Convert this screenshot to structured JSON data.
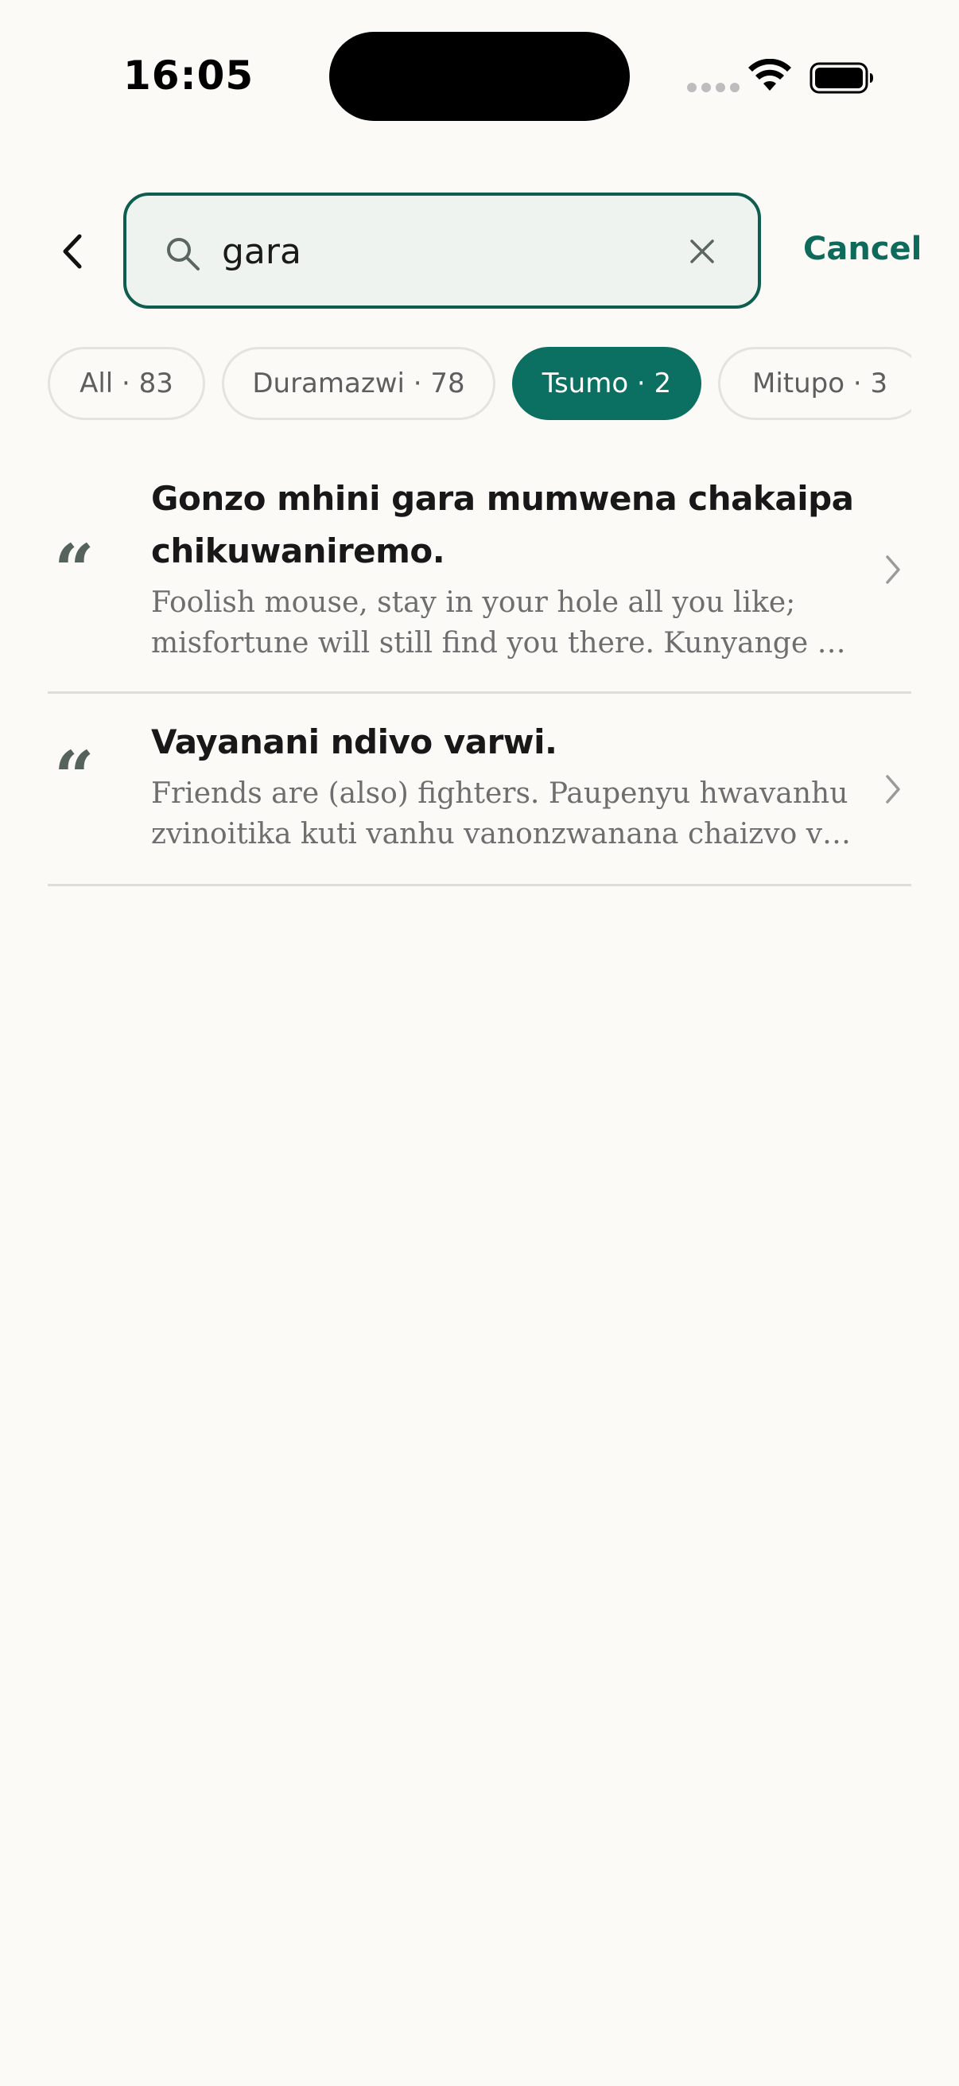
{
  "status_bar": {
    "time": "16:05"
  },
  "search": {
    "query": "gara",
    "cancel_label": "Cancel"
  },
  "filters": [
    {
      "label": "All · 83",
      "active": false
    },
    {
      "label": "Duramazwi · 78",
      "active": false
    },
    {
      "label": "Tsumo · 2",
      "active": true
    },
    {
      "label": "Mitupo · 3",
      "active": false
    }
  ],
  "results": [
    {
      "title": "Gonzo mhini gara mumwena chakaipa chikuwaniremo.",
      "snippet": "Foolish mouse, stay in your hole all you like; misfortune will still find you there. Kunyange …"
    },
    {
      "title": "Vayanani ndivo varwi.",
      "snippet": "Friends are (also) fighters. Paupenyu hwavanhu zvinoitika kuti vanhu vanonzwanana chaizvo v…"
    }
  ],
  "icons": {
    "back": "chevron-left-icon",
    "search": "search-icon",
    "clear": "close-icon",
    "quote": "quote-icon",
    "row": "chevron-right-icon"
  },
  "colors": {
    "accent": "#0B6F61",
    "background": "#FBFAF6",
    "search_fill": "#EFF3EF"
  }
}
